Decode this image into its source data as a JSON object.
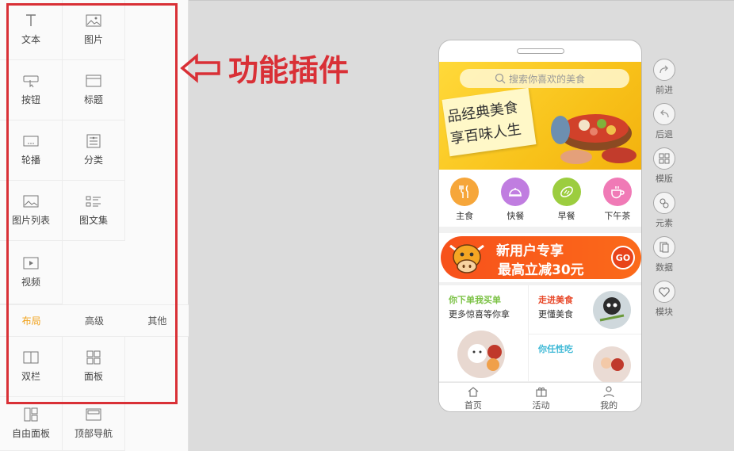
{
  "panel": {
    "items": [
      {
        "label": "文本",
        "icon": "text-icon"
      },
      {
        "label": "图片",
        "icon": "image-icon"
      },
      {
        "label": "按钮",
        "icon": "button-icon"
      },
      {
        "label": "标题",
        "icon": "title-icon"
      },
      {
        "label": "轮播",
        "icon": "carousel-icon"
      },
      {
        "label": "分类",
        "icon": "category-icon"
      },
      {
        "label": "图片列表",
        "icon": "image-list-icon"
      },
      {
        "label": "图文集",
        "icon": "text-image-set-icon"
      },
      {
        "label": "视频",
        "icon": "video-icon"
      }
    ],
    "tabs": [
      {
        "label": "布局",
        "active": true
      },
      {
        "label": "高级",
        "active": false
      },
      {
        "label": "其他",
        "active": false
      }
    ],
    "layout_items": [
      {
        "label": "双栏",
        "icon": "two-column-icon"
      },
      {
        "label": "面板",
        "icon": "panel-icon"
      },
      {
        "label": "自由面板",
        "icon": "free-panel-icon"
      },
      {
        "label": "顶部导航",
        "icon": "top-nav-icon"
      }
    ]
  },
  "annotation": {
    "text": "功能插件",
    "color": "#d93036"
  },
  "phone": {
    "search_placeholder": "搜索你喜欢的美食",
    "banner_line1": "品经典美食",
    "banner_line2": "享百味人生",
    "categories": [
      {
        "label": "主食",
        "color": "#f6a63a",
        "icon": "fork-knife-icon"
      },
      {
        "label": "快餐",
        "color": "#c07de0",
        "icon": "cloche-icon"
      },
      {
        "label": "早餐",
        "color": "#9ccd3f",
        "icon": "bread-icon"
      },
      {
        "label": "下午茶",
        "color": "#f07ab6",
        "icon": "cup-icon"
      }
    ],
    "promo": {
      "line1": "新用户专享",
      "line2": "最高立减30元",
      "go": "GO"
    },
    "tiles": [
      {
        "title": "你下单我买单",
        "sub": "更多惊喜等你拿",
        "title_color": "#7ac143"
      },
      {
        "title": "走进美食",
        "sub": "更懂美食",
        "title_color": "#e8492a"
      },
      {
        "title": "你任性吃",
        "sub": "",
        "title_color": "#3cb8d6"
      }
    ],
    "tabbar": [
      {
        "label": "首页",
        "icon": "home-icon"
      },
      {
        "label": "活动",
        "icon": "gift-icon"
      },
      {
        "label": "我的",
        "icon": "user-icon"
      }
    ]
  },
  "tools": [
    {
      "label": "前进",
      "icon": "redo-icon"
    },
    {
      "label": "后退",
      "icon": "undo-icon"
    },
    {
      "label": "模版",
      "icon": "template-icon"
    },
    {
      "label": "元素",
      "icon": "element-icon"
    },
    {
      "label": "数据",
      "icon": "data-icon"
    },
    {
      "label": "模块",
      "icon": "module-icon"
    }
  ]
}
